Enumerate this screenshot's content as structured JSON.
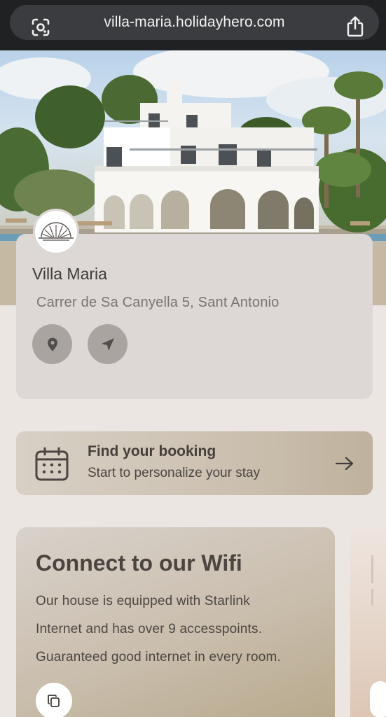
{
  "browser": {
    "url": "villa-maria.holidayhero.com",
    "left_icon": "lens-icon",
    "right_icon": "share-icon"
  },
  "villa": {
    "name": "Villa Maria",
    "address": "Carrer de Sa Canyella 5, Sant Antonio",
    "actions": [
      "location-pin-icon",
      "navigate-arrow-icon"
    ]
  },
  "booking": {
    "title": "Find your booking",
    "subtitle": "Start to personalize your stay",
    "icon": "calendar-icon",
    "arrow": "arrow-right-icon"
  },
  "wifi": {
    "title": "Connect to our Wifi",
    "lines": [
      "Our house is equipped with Starlink",
      "Internet and has over 9 accesspoints.",
      "Guaranteed good internet in every room."
    ],
    "button_icon": "copy-icon"
  },
  "colors": {
    "background": "#ebe6e2",
    "card": "#ddd8d5",
    "action_button": "#a9a4a0",
    "accent_gold": "#bfb29d"
  }
}
